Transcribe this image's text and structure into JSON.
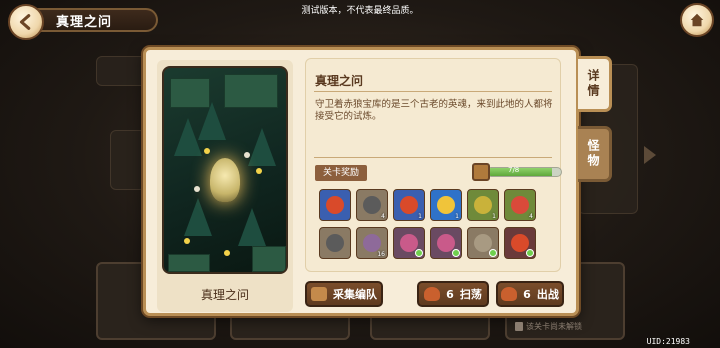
{
  "notice": "测试版本，不代表最终品质。",
  "header": {
    "title": "真理之问",
    "back_icon": "back-arrow-icon",
    "home_icon": "home-icon"
  },
  "stage": {
    "card_label": "真理之问",
    "name": "真理之问",
    "description": "守卫着赤狼宝库的是三个古老的英魂，来到此地的人都将接受它的试炼。",
    "reward_tag": "关卡奖励",
    "progress": {
      "current": 7,
      "total": 8,
      "label": "7/8"
    }
  },
  "tabs": [
    {
      "label": "详情",
      "active": true
    },
    {
      "label": "怪物",
      "active": false
    }
  ],
  "rewards": [
    {
      "name": "hero-portrait",
      "count": "",
      "bg": "#3a5fb0",
      "glyph": "#d94a2a",
      "checked": false
    },
    {
      "name": "pickaxe",
      "count": "4",
      "bg": "#8a7a64",
      "glyph": "#5b5b5b",
      "checked": false
    },
    {
      "name": "hero-portrait",
      "count": "1",
      "bg": "#3a5fb0",
      "glyph": "#d94a2a",
      "checked": false
    },
    {
      "name": "golden-token",
      "count": "1",
      "bg": "#2f72c9",
      "glyph": "#f0c43a",
      "checked": false
    },
    {
      "name": "gourd",
      "count": "1",
      "bg": "#6f8a3a",
      "glyph": "#c9b23a",
      "checked": false
    },
    {
      "name": "mushroom",
      "count": "4",
      "bg": "#6f8a3a",
      "glyph": "#d94a3a",
      "checked": false
    },
    {
      "name": "pickaxe",
      "count": "",
      "bg": "#8a7a64",
      "glyph": "#5b5b5b",
      "checked": false
    },
    {
      "name": "worm",
      "count": "16",
      "bg": "#8a7a64",
      "glyph": "#8e6a9a",
      "checked": false
    },
    {
      "name": "crystal-shard",
      "count": "",
      "bg": "#6a4a62",
      "glyph": "#c95a8a",
      "checked": true
    },
    {
      "name": "crystal-shard",
      "count": "",
      "bg": "#6a4a62",
      "glyph": "#c95a8a",
      "checked": true
    },
    {
      "name": "map-scroll",
      "count": "",
      "bg": "#8a7a64",
      "glyph": "#a89a82",
      "checked": true
    },
    {
      "name": "hero-portrait",
      "count": "",
      "bg": "#6a3a3a",
      "glyph": "#d94a2a",
      "checked": true
    }
  ],
  "buttons": {
    "team": {
      "label": "采集编队",
      "icon": "pickaxe-icon"
    },
    "sweep": {
      "count": "6",
      "label": "扫荡",
      "icon": "meat-icon"
    },
    "battle": {
      "count": "6",
      "label": "出战",
      "icon": "meat-icon"
    }
  },
  "locked_text": "该关卡尚未解锁",
  "uid": "UID:21983"
}
